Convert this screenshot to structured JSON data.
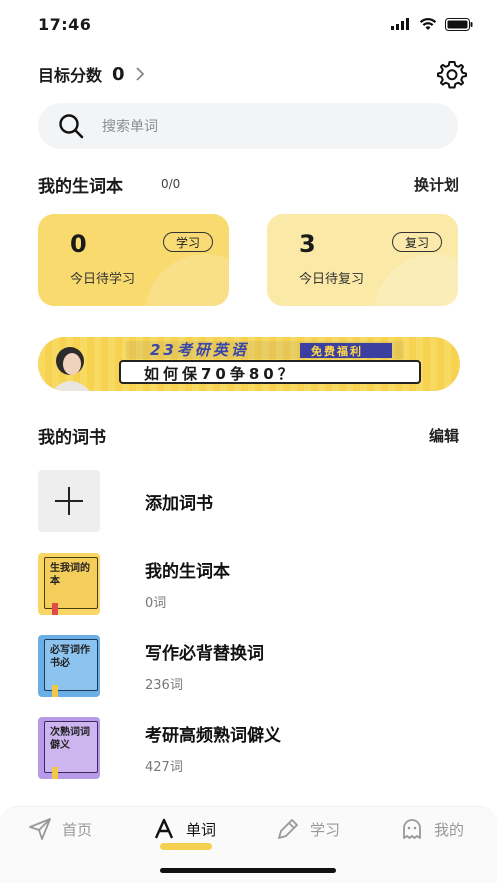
{
  "status": {
    "time": "17:46"
  },
  "header": {
    "target_label": "目标分数",
    "target_value": "0"
  },
  "search": {
    "placeholder": "搜索单词"
  },
  "wordbook_section": {
    "title": "我的生词本",
    "count": "0/0",
    "link": "换计划"
  },
  "cards": [
    {
      "number": "0",
      "label": "今日待学习",
      "badge": "学习"
    },
    {
      "number": "3",
      "label": "今日待复习",
      "badge": "复习"
    }
  ],
  "banner": {
    "tag": "免费福利",
    "headline": "23考研英语",
    "subline": "如何保70争80？"
  },
  "books_section": {
    "title": "我的词书",
    "link": "编辑"
  },
  "books": [
    {
      "title": "添加词书",
      "count": ""
    },
    {
      "title": "我的生词本",
      "count": "0词",
      "cover_text": "生我词的本",
      "cover_color": "#f8d766"
    },
    {
      "title": "写作必背替换词",
      "count": "236词",
      "cover_text": "必写词作书必",
      "cover_color": "#6aaee6"
    },
    {
      "title": "考研高频熟词僻义",
      "count": "427词",
      "cover_text": "次熟词词僻义",
      "cover_color": "#b89ae8"
    }
  ],
  "tabbar": {
    "items": [
      {
        "label": "首页",
        "icon": "paper-plane-icon"
      },
      {
        "label": "单词",
        "icon": "letter-a-icon"
      },
      {
        "label": "学习",
        "icon": "pen-icon"
      },
      {
        "label": "我的",
        "icon": "ghost-icon"
      }
    ]
  },
  "colors": {
    "accent": "#f5d04e",
    "card_learn": "#f8da6e",
    "card_review": "#fbe9a8"
  }
}
